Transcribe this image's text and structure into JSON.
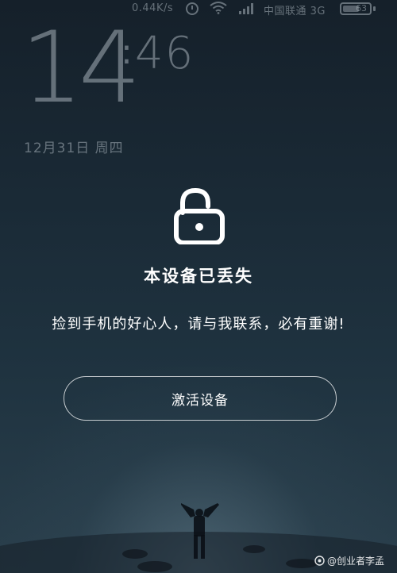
{
  "status_bar": {
    "network_speed": "0.44K/s",
    "carrier": "中国联通 3G",
    "battery_level": "63",
    "battery_fraction": 0.63
  },
  "lockscreen": {
    "time_hours": "14",
    "time_separator": ":",
    "time_minutes": "46",
    "date": "12月31日 周四"
  },
  "lost_notice": {
    "icon": "unlocked-padlock-icon",
    "title": "本设备已丢失",
    "message": "捡到手机的好心人，请与我联系，必有重谢!",
    "activate_button_label": "激活设备"
  },
  "watermark": {
    "text": "@创业者李孟"
  },
  "colors": {
    "background_top": "#15202a",
    "background_bottom": "#2a3f4c",
    "text_primary": "#ffffff",
    "text_dim": "#aab4bc"
  }
}
